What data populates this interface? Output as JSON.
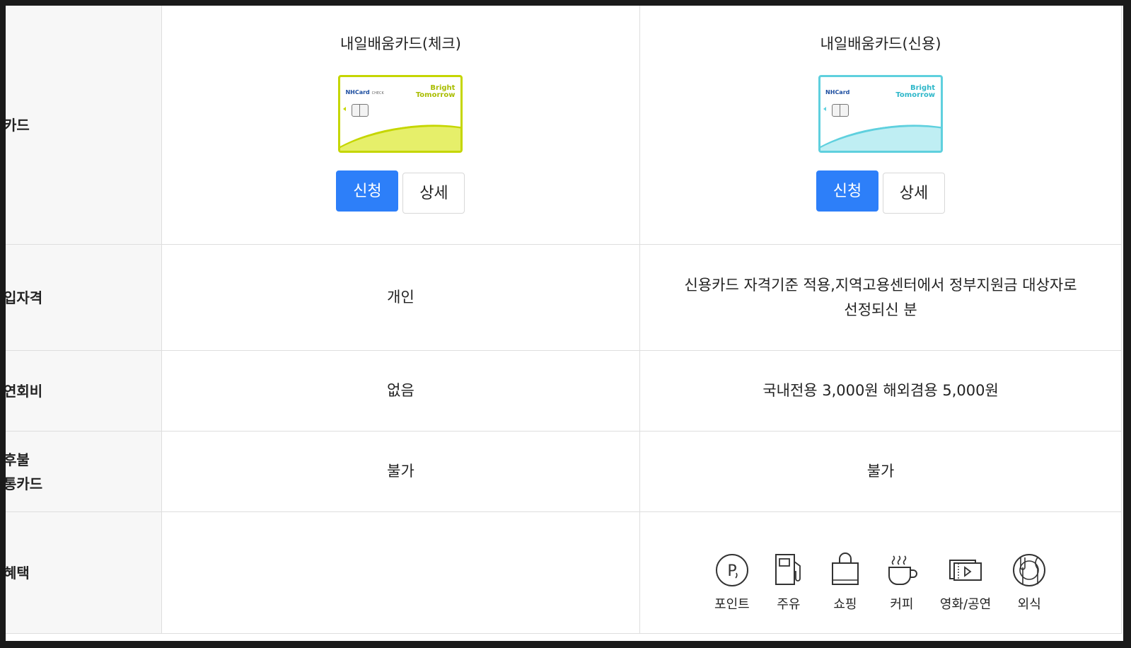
{
  "rows": {
    "card": {
      "label": "카드"
    },
    "eligibility": {
      "label": "입자격",
      "check": "개인",
      "credit_line1": "신용카드 자격기준 적용,지역고용센터에서 정부지원금 대상자로",
      "credit_line2": "선정되신 분"
    },
    "fee": {
      "label": "연회비",
      "check": "없음",
      "credit": "국내전용 3,000원 해외겸용 5,000원"
    },
    "deferred": {
      "label_line1": "후불",
      "label_line2": "통카드",
      "check": "불가",
      "credit": "불가"
    },
    "benefits": {
      "label": "혜택"
    }
  },
  "cards": {
    "check": {
      "title": "내일배움카드(체크)",
      "brand": "NHCard",
      "brand_sub": "CHECK",
      "slogan1": "Bright",
      "slogan2": "Tomorrow",
      "apply": "신청",
      "detail": "상세"
    },
    "credit": {
      "title": "내일배움카드(신용)",
      "brand": "NHCard",
      "slogan1": "Bright",
      "slogan2": "Tomorrow",
      "apply": "신청",
      "detail": "상세"
    }
  },
  "benefit_items": [
    {
      "label": "포인트",
      "icon": "point-icon"
    },
    {
      "label": "주유",
      "icon": "fuel-icon"
    },
    {
      "label": "쇼핑",
      "icon": "shopping-bag-icon"
    },
    {
      "label": "커피",
      "icon": "coffee-icon"
    },
    {
      "label": "영화/공연",
      "icon": "ticket-icon"
    },
    {
      "label": "외식",
      "icon": "dining-icon"
    }
  ],
  "colors": {
    "apply_button": "#2d7ff9",
    "check_card": "#c5d600",
    "credit_card": "#5fd0de"
  }
}
